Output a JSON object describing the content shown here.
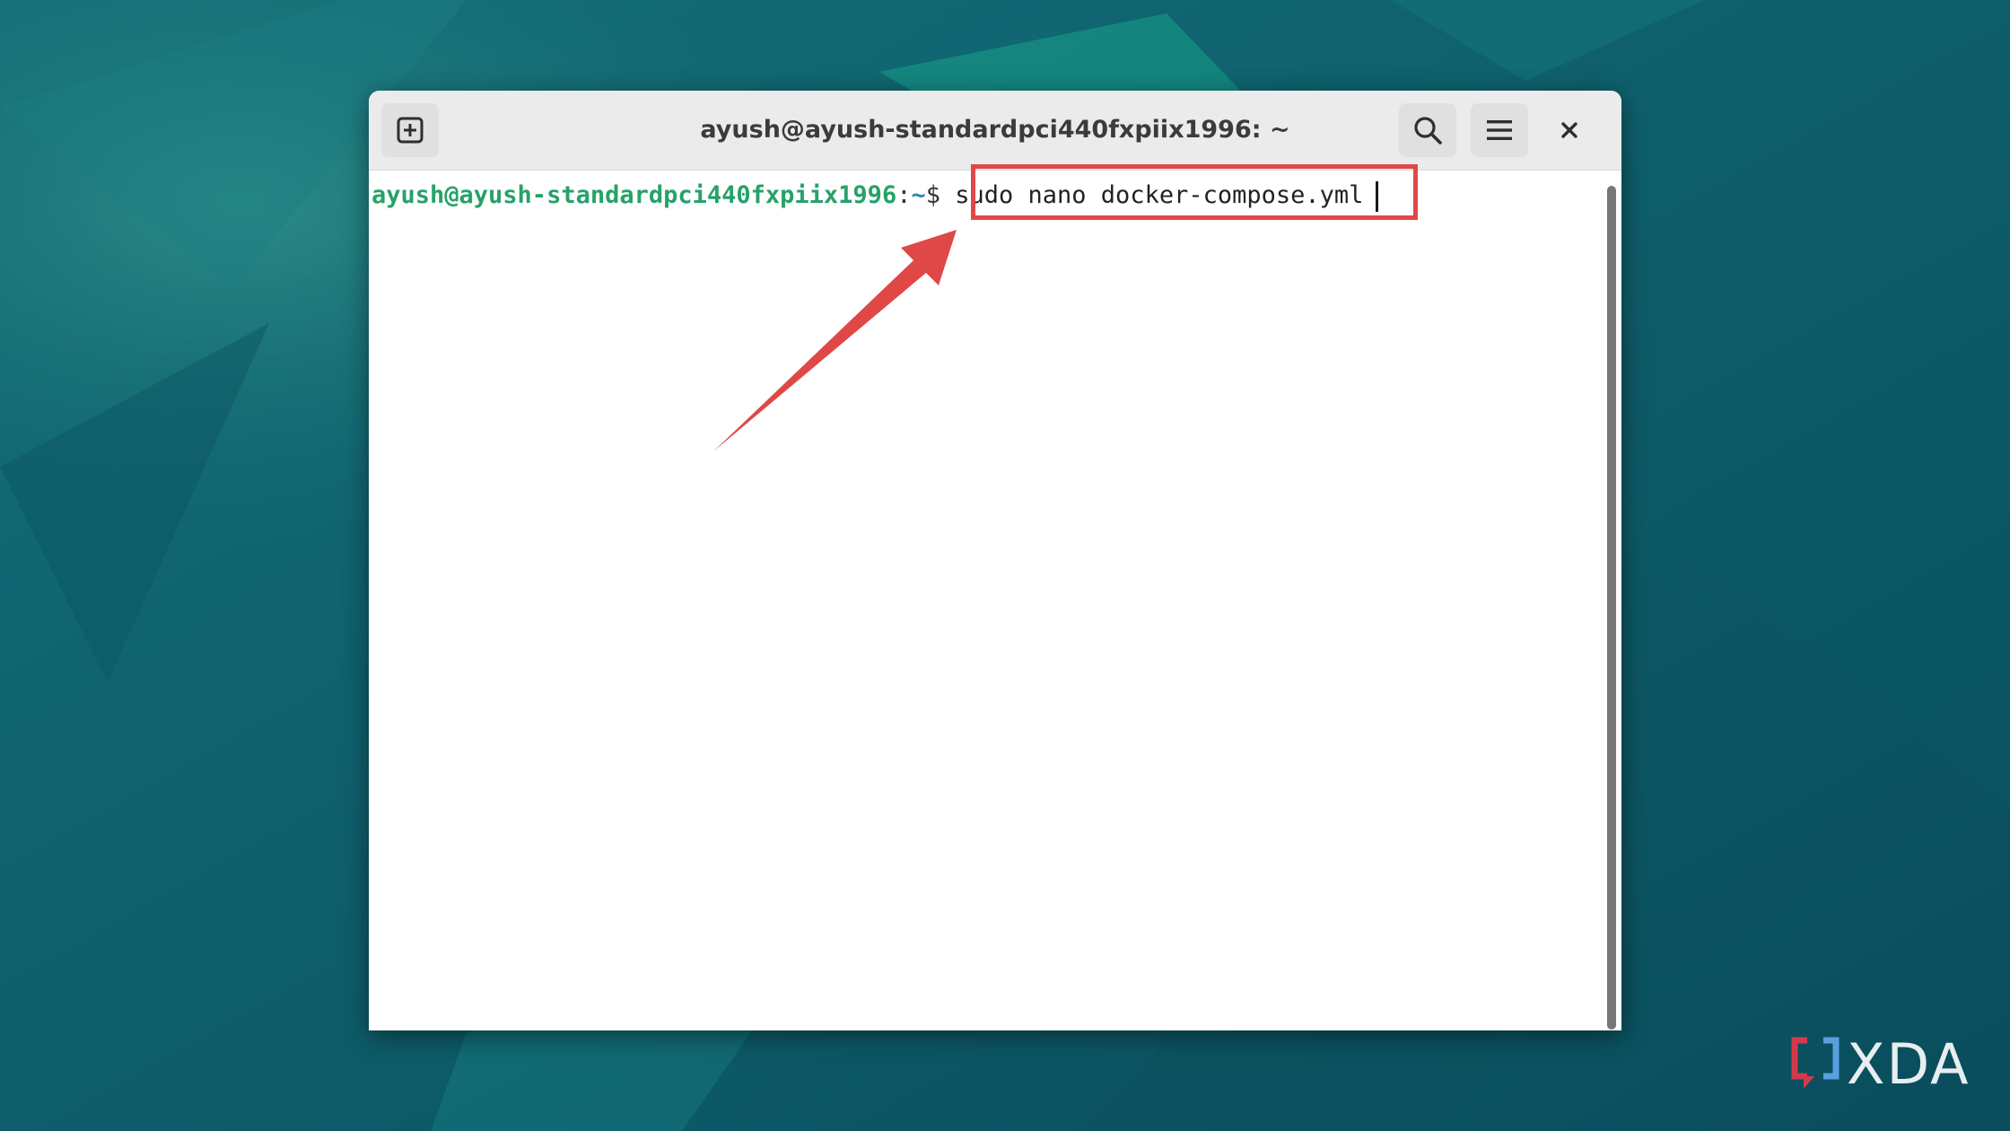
{
  "window": {
    "title": "ayush@ayush-standardpci440fxpiix1996: ~"
  },
  "toolbar": {
    "new_tab_icon": "new-tab-icon",
    "search_icon": "search-icon",
    "menu_icon": "hamburger-menu-icon",
    "close_icon": "close-icon"
  },
  "terminal": {
    "prompt_user": "ayush@ayush-standardpci440fxpiix1996",
    "prompt_sep": ":",
    "prompt_path": "~",
    "prompt_dollar": "$ ",
    "command": "sudo nano docker-compose.yml"
  },
  "annotation": {
    "color": "#e04848"
  },
  "watermark": {
    "text": "XDA"
  }
}
